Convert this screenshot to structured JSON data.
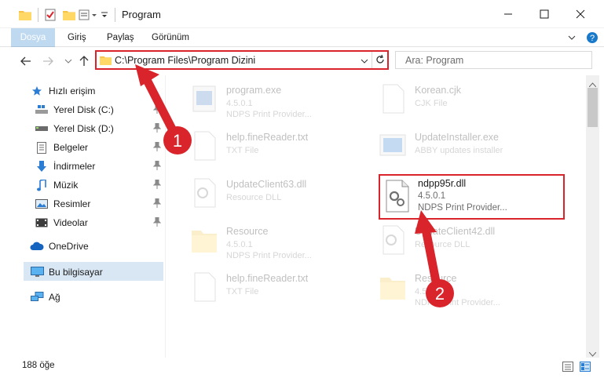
{
  "window": {
    "title": "Program",
    "minimize_icon": "minimize-icon",
    "maximize_icon": "maximize-icon",
    "close_icon": "close-icon"
  },
  "ribbon": {
    "tabs": [
      {
        "label": "Dosya"
      },
      {
        "label": "Giriş"
      },
      {
        "label": "Paylaş"
      },
      {
        "label": "Görünüm"
      }
    ]
  },
  "address": {
    "path": "C:\\Program Files\\Program Dizini",
    "search_placeholder": "Ara: Program"
  },
  "sidebar": {
    "items": [
      {
        "label": "Hızlı erişim",
        "icon": "star-icon"
      },
      {
        "label": "Yerel Disk (C:)",
        "icon": "drive-icon",
        "pinned": true
      },
      {
        "label": "Yerel Disk (D:)",
        "icon": "drive-icon",
        "pinned": true
      },
      {
        "label": "Belgeler",
        "icon": "document-icon",
        "pinned": true
      },
      {
        "label": "İndirmeler",
        "icon": "download-icon",
        "pinned": true
      },
      {
        "label": "Müzik",
        "icon": "music-icon",
        "pinned": true
      },
      {
        "label": "Resimler",
        "icon": "pictures-icon",
        "pinned": true
      },
      {
        "label": "Videolar",
        "icon": "videos-icon",
        "pinned": true
      },
      {
        "label": "OneDrive",
        "icon": "cloud-icon"
      },
      {
        "label": "Bu bilgisayar",
        "icon": "computer-icon",
        "selected": true
      },
      {
        "label": "Ağ",
        "icon": "network-icon"
      }
    ]
  },
  "files": [
    {
      "name": "program.exe",
      "meta1": "4.5.0.1",
      "meta2": "NDPS Print Provider..."
    },
    {
      "name": "Korean.cjk",
      "meta1": "CJK File",
      "meta2": ""
    },
    {
      "name": "help.fineReader.txt",
      "meta1": "TXT File",
      "meta2": ""
    },
    {
      "name": "UpdateInstaller.exe",
      "meta1": "ABBY updates installer",
      "meta2": ""
    },
    {
      "name": "UpdateClient63.dll",
      "meta1": "Resource DLL",
      "meta2": ""
    },
    {
      "name": "ndpp95r.dll",
      "meta1": "4.5.0.1",
      "meta2": "NDPS Print Provider..."
    },
    {
      "name": "Resource",
      "meta1": "4.5.0.1",
      "meta2": "NDPS Print Provider..."
    },
    {
      "name": "UpdateClient42.dll",
      "meta1": "Resource DLL",
      "meta2": ""
    },
    {
      "name": "help.fineReader.txt",
      "meta1": "TXT File",
      "meta2": ""
    },
    {
      "name": "Resource",
      "meta1": "4.5.0.1",
      "meta2": "NDPS Print Provider..."
    }
  ],
  "status": {
    "count": "188 öğe"
  },
  "annotations": {
    "step1": "1",
    "step2": "2",
    "accent": "#d9242b"
  },
  "colors": {
    "ribbon_file_tab": "#1979ca",
    "selection": "#d9e6f3",
    "highlight_border": "#d9242b"
  }
}
